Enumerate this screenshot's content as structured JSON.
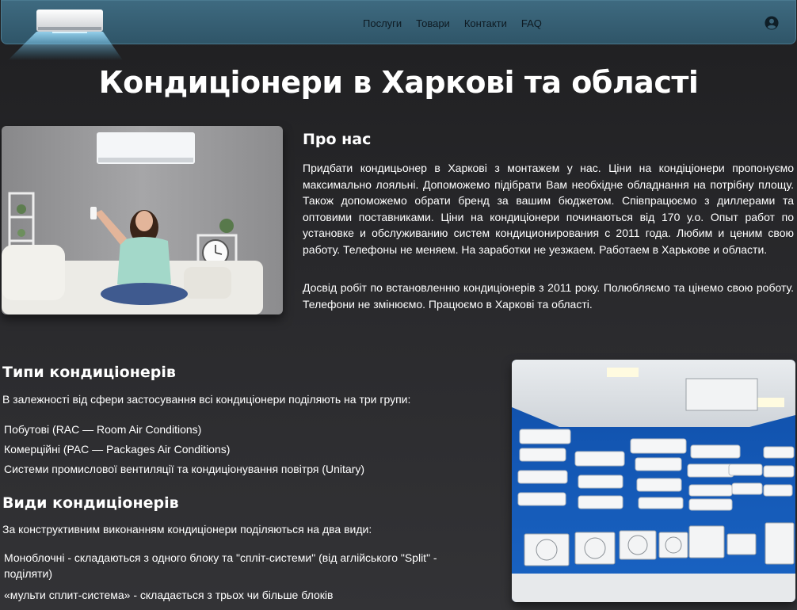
{
  "nav": {
    "links": [
      "Послуги",
      "Товари",
      "Контакти",
      "FAQ"
    ]
  },
  "colors": {
    "navbar": "#3a6479",
    "background": "#2a2a2c",
    "text": "#ffffff"
  },
  "hero": {
    "title": "Кондиціонери в Харкові та області"
  },
  "about": {
    "title": "Про нас",
    "p1": "Придбати кондицьонер в Харкові з монтажем у нас. Ціни на кондіціонери пропонуємо максимально лояльні. Допоможемо підібрати Вам необхідне обладнання на потрібну площу. Також допоможемо обрати бренд за вашим бюджетом. Співпрацюємо з диллерами та оптовими поставниками. Ціни на кондиціонери починаються від 170 у.о. Опыт работ по установке и обслуживанию систем кондиционирования с 2011 года. Любим и ценим свою работу. Телефоны не меняем. На заработки не уезжаем. Работаем в Харькове и области.",
    "p2": "Досвід робіт по встановленню кондиціонерів з 2011 року. Полюбляємо та цінемо свою роботу. Телефони не змінюємо. Працюємо в Харкові та області."
  },
  "types": {
    "title": "Типи кондиціонерів",
    "intro": "В залежності від сфери застосування всі кондиціонери поділяють на три групи:",
    "items": [
      "Побутові (RAC — Room Air Conditions)",
      "Комерційні (PAC — Packages Air Conditions)",
      "Системи промислової вентиляції та кондиціонування повітря (Unitary)"
    ]
  },
  "kinds": {
    "title": "Види кондиціонерів",
    "intro": "За конструктивним виконанням кондиціонери поділяються на два види:",
    "items": [
      "Моноблочні - складаються з одного блоку та \"спліт-системи\" (від аглійського \"Split\" - поділяти)",
      "«мульти сплит-система» - складається з трьох чи більше блоків"
    ]
  },
  "icons": {
    "user": "user-circle-icon",
    "logo": "air-conditioner-logo"
  }
}
